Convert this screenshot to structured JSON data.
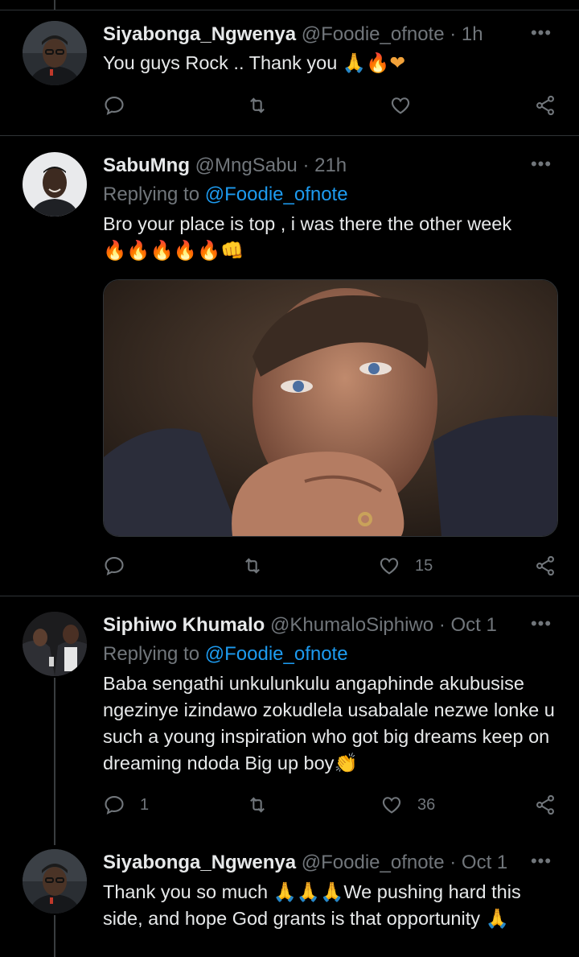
{
  "tweets": [
    {
      "name": "Siyabonga_Ngwenya",
      "handle": "@Foodie_ofnote",
      "time": "· 1h",
      "text": "You guys Rock .. Thank you ",
      "text_emoji": "🙏🔥❤",
      "replies": "",
      "likes": ""
    },
    {
      "name": "SabuMng",
      "handle": "@MngSabu",
      "time": "· 21h",
      "replying_label": "Replying to ",
      "replying_handle": "@Foodie_ofnote",
      "text": "Bro your place is top , i was there the other week",
      "text_emoji": "🔥🔥🔥🔥🔥👊",
      "image": "crying-man-photo",
      "replies": "",
      "likes": "15"
    },
    {
      "name": "Siphiwo Khumalo",
      "handle": "@KhumaloSiphiwo",
      "time": "· Oct 1",
      "replying_label": "Replying to ",
      "replying_handle": "@Foodie_ofnote",
      "text": "Baba sengathi unkulunkulu angaphinde akubusise ngezinye izindawo zokudlela usabalale nezwe lonke u such a young inspiration who got big dreams keep on dreaming ndoda Big up boy",
      "text_emoji": "👏",
      "replies": "1",
      "likes": "36"
    },
    {
      "name": "Siyabonga_Ngwenya",
      "handle": "@Foodie_ofnote",
      "time": "· Oct 1",
      "text_a": "Thank you so much ",
      "text_emoji_a": "🙏🙏🙏",
      "text_b": "We pushing hard this side, and hope God grants is that opportunity ",
      "text_emoji_b": "🙏"
    }
  ],
  "icons": {
    "reply": "reply-icon",
    "retweet": "retweet-icon",
    "like": "heart-icon",
    "share": "share-icon",
    "more": "more-icon"
  },
  "colors": {
    "background": "#000000",
    "link": "#1d9bf0",
    "muted": "#71767b",
    "text": "#e7e9ea"
  }
}
